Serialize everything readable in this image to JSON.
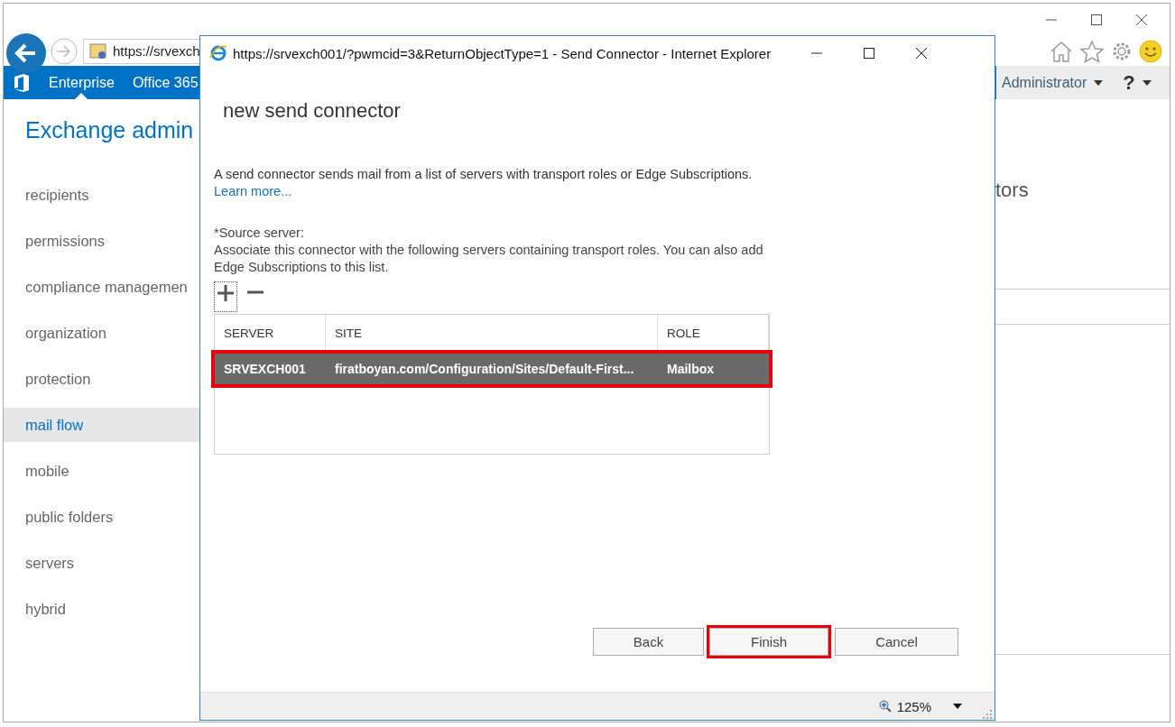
{
  "browser": {
    "address": "https://srvexch",
    "tabs": [
      {
        "label": "Enterprise",
        "selected": true
      },
      {
        "label": "Office 365",
        "selected": false
      }
    ],
    "user": "Administrator",
    "help": "?"
  },
  "page": {
    "title": "Exchange admin",
    "nav": [
      {
        "label": "recipients",
        "selected": false
      },
      {
        "label": "permissions",
        "selected": false
      },
      {
        "label": "compliance managemen",
        "selected": false
      },
      {
        "label": "organization",
        "selected": false
      },
      {
        "label": "protection",
        "selected": false
      },
      {
        "label": "mail flow",
        "selected": true
      },
      {
        "label": "mobile",
        "selected": false
      },
      {
        "label": "public folders",
        "selected": false
      },
      {
        "label": "servers",
        "selected": false
      },
      {
        "label": "hybrid",
        "selected": false
      }
    ],
    "side_text": "tors"
  },
  "dialog": {
    "title": "https://srvexch001/?pwmcid=3&ReturnObjectType=1 - Send Connector - Internet Explorer",
    "heading": "new send connector",
    "description": "A send connector sends mail from a list of servers with transport roles or Edge Subscriptions.",
    "link": "Learn more...",
    "field_label": "*Source server:",
    "field_help": "Associate this connector with the following servers containing transport roles. You can also add Edge Subscriptions to this list.",
    "table": {
      "columns": [
        "SERVER",
        "SITE",
        "ROLE"
      ],
      "rows": [
        {
          "cells": [
            "SRVEXCH001",
            "firatboyan.com/Configuration/Sites/Default-First...",
            "Mailbox"
          ],
          "selected": true,
          "annotated": true
        }
      ]
    },
    "buttons": [
      {
        "label": "Back",
        "annotated": false
      },
      {
        "label": "Finish",
        "annotated": true
      },
      {
        "label": "Cancel",
        "annotated": false
      }
    ],
    "zoom": "125%"
  }
}
